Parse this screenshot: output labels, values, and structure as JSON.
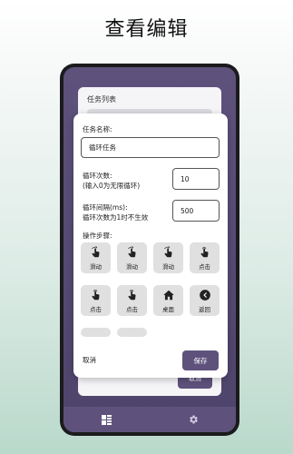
{
  "promo": {
    "title": "查看编辑"
  },
  "background_screen": {
    "card_title": "任务列表",
    "cancel_label": "取消"
  },
  "dialog": {
    "task_name_label": "任务名称:",
    "task_name_value": "循环任务",
    "loop_count_label_line1": "循环次数:",
    "loop_count_label_line2": "(输入0为无限循环)",
    "loop_count_value": "10",
    "loop_interval_label_line1": "循环间隔(ms):",
    "loop_interval_label_line2": "循环次数为1时不生效",
    "loop_interval_value": "500",
    "steps_label": "操作步骤:",
    "steps": [
      {
        "label": "滑动",
        "icon": "swipe-hand-icon"
      },
      {
        "label": "滑动",
        "icon": "swipe-hand-icon"
      },
      {
        "label": "滑动",
        "icon": "swipe-hand-icon"
      },
      {
        "label": "点击",
        "icon": "tap-hand-icon"
      },
      {
        "label": "点击",
        "icon": "tap-hand-icon"
      },
      {
        "label": "点击",
        "icon": "tap-hand-icon"
      },
      {
        "label": "桌面",
        "icon": "home-icon"
      },
      {
        "label": "返回",
        "icon": "back-icon"
      }
    ],
    "cancel_label": "取消",
    "save_label": "保存"
  },
  "colors": {
    "accent": "#5e527c",
    "tile": "#e0e0e0"
  }
}
